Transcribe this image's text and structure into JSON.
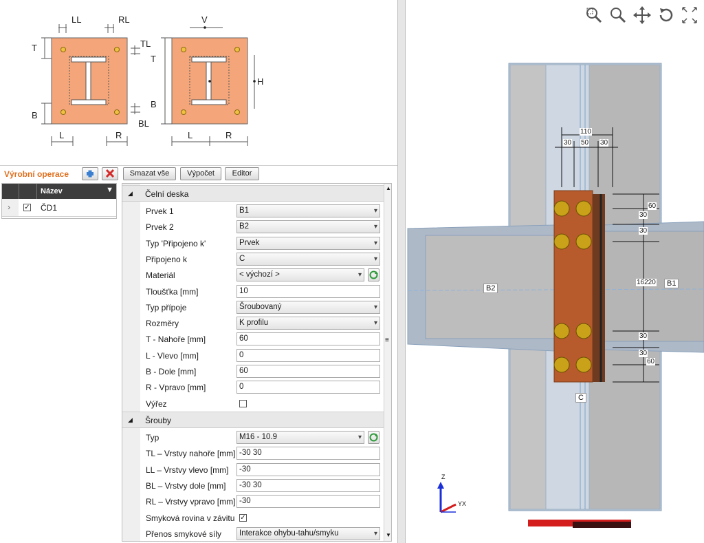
{
  "sketch": {
    "left": {
      "LL": "LL",
      "RL": "RL",
      "T": "T",
      "TL": "TL",
      "B": "B",
      "BL": "BL",
      "L": "L",
      "R": "R"
    },
    "right": {
      "V": "V",
      "T": "T",
      "H": "H",
      "B": "B",
      "L": "L",
      "R": "R"
    }
  },
  "toolbar": {
    "title": "Výrobní operace",
    "delete_all": "Smazat vše",
    "calculation": "Výpočet",
    "editor": "Editor"
  },
  "list": {
    "column_name": "Název",
    "rows": [
      {
        "name": "ČD1",
        "checked": true
      }
    ]
  },
  "props": {
    "section1": "Čelní deska",
    "rows1": [
      {
        "label": "Prvek 1",
        "value": "B1",
        "type": "select"
      },
      {
        "label": "Prvek 2",
        "value": "B2",
        "type": "select"
      },
      {
        "label": "Typ 'Připojeno k'",
        "value": "Prvek",
        "type": "select"
      },
      {
        "label": "Připojeno k",
        "value": "C",
        "type": "select"
      },
      {
        "label": "Materiál",
        "value": "< výchozí >",
        "type": "select-refresh"
      },
      {
        "label": "Tloušťka [mm]",
        "value": "10",
        "type": "text"
      },
      {
        "label": "Typ přípoje",
        "value": "Šroubovaný",
        "type": "select"
      },
      {
        "label": "Rozměry",
        "value": "K profilu",
        "type": "select"
      },
      {
        "label": "T - Nahoře [mm]",
        "value": "60",
        "type": "text"
      },
      {
        "label": "L - Vlevo [mm]",
        "value": "0",
        "type": "text"
      },
      {
        "label": "B - Dole [mm]",
        "value": "60",
        "type": "text"
      },
      {
        "label": "R - Vpravo [mm]",
        "value": "0",
        "type": "text"
      },
      {
        "label": "Výřez",
        "value": "",
        "type": "check"
      }
    ],
    "section2": "Šrouby",
    "rows2": [
      {
        "label": "Typ",
        "value": "M16 - 10.9",
        "type": "select-refresh"
      },
      {
        "label": "TL – Vrstvy nahoře [mm]",
        "value": "-30 30",
        "type": "text"
      },
      {
        "label": "LL – Vrstvy vlevo [mm]",
        "value": "-30",
        "type": "text"
      },
      {
        "label": "BL – Vrstvy dole [mm]",
        "value": "-30 30",
        "type": "text"
      },
      {
        "label": "RL – Vrstvy vpravo [mm]",
        "value": "-30",
        "type": "text"
      },
      {
        "label": "Smyková rovina v závitu",
        "value": "",
        "type": "check-on"
      },
      {
        "label": "Přenos smykové síly",
        "value": "Interakce ohybu-tahu/smyku",
        "type": "select"
      }
    ]
  },
  "view3d": {
    "dims": {
      "d110": "110",
      "d30a": "30",
      "d50": "50",
      "d30b": "30",
      "r60a": "60",
      "r30a": "30",
      "r30b": "30",
      "r16220": "16220",
      "r30c": "30",
      "r30d": "30",
      "r60b": "60"
    },
    "labels": {
      "b2": "B2",
      "b1": "B1",
      "c": "C"
    },
    "axes": {
      "z": "Z",
      "yx": "YX"
    }
  }
}
